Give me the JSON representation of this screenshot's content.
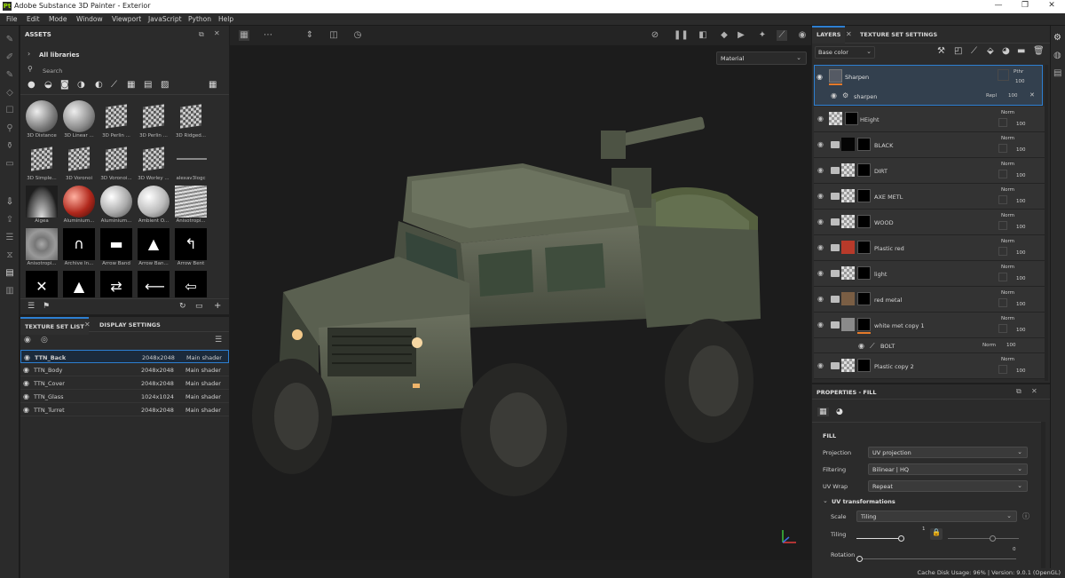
{
  "window": {
    "title": "Adobe Substance 3D Painter - Exterior",
    "app_icon": "Pt",
    "controls": [
      "—",
      "❐",
      "✕"
    ]
  },
  "menu": [
    "File",
    "Edit",
    "Mode",
    "Window",
    "Viewport",
    "JavaScript",
    "Python",
    "Help"
  ],
  "assets": {
    "title": "ASSETS",
    "library": "All libraries",
    "search_placeholder": "Search",
    "items": [
      "3D Distance",
      "3D Linear ...",
      "3D Perlin ...",
      "3D Perlin ...",
      "3D Ridged...",
      "3D Simple...",
      "3D Voronoi",
      "3D Voronoi...",
      "3D Worley ...",
      "alexav3logc",
      "Algea",
      "Aluminium...",
      "Aluminium...",
      "Ambient O...",
      "Anisotropi...",
      "Anisotropi...",
      "Archive In...",
      "Arrow Band",
      "Arrow Ban...",
      "Arrow Bent",
      "",
      "",
      "",
      "",
      ""
    ]
  },
  "texture_set": {
    "tabs": [
      "TEXTURE SET LIST",
      "DISPLAY SETTINGS"
    ],
    "rows": [
      {
        "name": "TTN_Back",
        "res": "2048x2048",
        "shader": "Main shader"
      },
      {
        "name": "TTN_Body",
        "res": "2048x2048",
        "shader": "Main shader"
      },
      {
        "name": "TTN_Cover",
        "res": "2048x2048",
        "shader": "Main shader"
      },
      {
        "name": "TTN_Glass",
        "res": "1024x1024",
        "shader": "Main shader"
      },
      {
        "name": "TTN_Turret",
        "res": "2048x2048",
        "shader": "Main shader"
      }
    ]
  },
  "viewport": {
    "display_mode": "Material"
  },
  "layers": {
    "tabs": [
      "LAYERS",
      "TEXTURE SET SETTINGS"
    ],
    "channel": "Base color",
    "top_layer": {
      "name": "Sharpen",
      "blend": "Pthr",
      "opacity": "100"
    },
    "filter": {
      "name": "sharpen",
      "blend": "Repl",
      "opacity": "100"
    },
    "rows": [
      {
        "name": "HEight",
        "blend": "Norm",
        "opacity": "100",
        "color": "checker"
      },
      {
        "name": "BLACK",
        "blend": "Norm",
        "opacity": "100",
        "color": "#050505"
      },
      {
        "name": "DIRT",
        "blend": "Norm",
        "opacity": "100",
        "color": "checker"
      },
      {
        "name": "AXE METL",
        "blend": "Norm",
        "opacity": "100",
        "color": "checker"
      },
      {
        "name": "WOOD",
        "blend": "Norm",
        "opacity": "100",
        "color": "checker"
      },
      {
        "name": "Plastic red",
        "blend": "Norm",
        "opacity": "100",
        "color": "#b83a2a"
      },
      {
        "name": "light",
        "blend": "Norm",
        "opacity": "100",
        "color": "checker"
      },
      {
        "name": "red metal",
        "blend": "Norm",
        "opacity": "100",
        "color": "#7a5e44"
      },
      {
        "name": "white met copy 1",
        "blend": "Norm",
        "opacity": "100",
        "color": "#8a8a8a"
      },
      {
        "name": "Plastic copy 2",
        "blend": "Norm",
        "opacity": "100",
        "color": "checker"
      }
    ],
    "sub": {
      "name": "BOLT",
      "blend": "Norm",
      "opacity": "100"
    }
  },
  "properties": {
    "title": "PROPERTIES - FILL",
    "section": "FILL",
    "projection": {
      "label": "Projection",
      "value": "UV projection"
    },
    "filtering": {
      "label": "Filtering",
      "value": "Bilinear | HQ"
    },
    "uvwrap": {
      "label": "UV Wrap",
      "value": "Repeat"
    },
    "uvt": "UV transformations",
    "scale": {
      "label": "Scale",
      "value": "Tiling"
    },
    "tiling": {
      "label": "Tiling",
      "value": "1"
    },
    "rotation": {
      "label": "Rotation",
      "value": "0"
    }
  },
  "status": "Cache Disk Usage:   96%  |  Version: 9.0.1 (OpenGL)",
  "colors": {
    "panel": "#2b2b2b",
    "accent": "#2d7fd1",
    "selected_row": "#1b2a3b"
  }
}
